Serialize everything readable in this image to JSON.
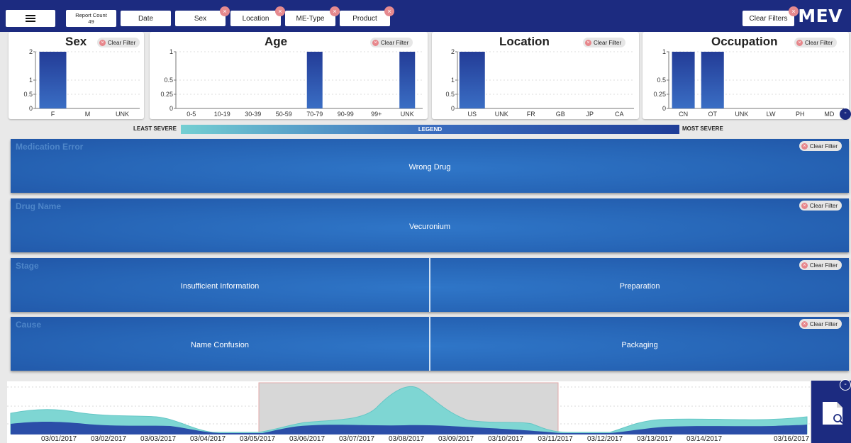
{
  "toolbar": {
    "report_count_label": "Report Count",
    "report_count_value": "49",
    "filters": [
      "Date",
      "Sex",
      "Location",
      "ME-Type",
      "Product"
    ],
    "clear_filters": "Clear Filters",
    "logo": "MEV"
  },
  "panels": {
    "clear_filter": "Clear Filter",
    "sex": {
      "title": "Sex",
      "categories": [
        "F",
        "M",
        "UNK"
      ],
      "values": [
        2,
        0,
        0
      ],
      "yticks": [
        "2",
        "1",
        "0.5",
        "0"
      ]
    },
    "age": {
      "title": "Age",
      "categories": [
        "0-5",
        "10-19",
        "30-39",
        "50-59",
        "70-79",
        "90-99",
        "99+",
        "UNK"
      ],
      "values": [
        0,
        0,
        0,
        0,
        1,
        0,
        0,
        1
      ],
      "yticks": [
        "1",
        "0.5",
        "0.25",
        "0"
      ]
    },
    "location": {
      "title": "Location",
      "categories": [
        "US",
        "UNK",
        "FR",
        "GB",
        "JP",
        "CA"
      ],
      "values": [
        2,
        0,
        0,
        0,
        0,
        0
      ],
      "yticks": [
        "2",
        "1",
        "0.5",
        "0"
      ]
    },
    "occupation": {
      "title": "Occupation",
      "categories": [
        "CN",
        "OT",
        "UNK",
        "LW",
        "PH",
        "MD"
      ],
      "values": [
        1,
        1,
        0,
        0,
        0,
        0
      ],
      "yticks": [
        "1",
        "0.5",
        "0.25",
        "0"
      ]
    },
    "toggle": "-"
  },
  "legend": {
    "least": "LEAST SEVERE",
    "center": "LEGEND",
    "most": "MOST SEVERE"
  },
  "categories": {
    "clear_filter": "Clear Filter",
    "medication_error": {
      "label": "Medication Error",
      "values": [
        "Wrong Drug"
      ]
    },
    "drug_name": {
      "label": "Drug Name",
      "values": [
        "Vecuronium"
      ]
    },
    "stage": {
      "label": "Stage",
      "values": [
        "Insufficient Information",
        "Preparation"
      ]
    },
    "cause": {
      "label": "Cause",
      "values": [
        "Name Confusion",
        "Packaging"
      ]
    }
  },
  "timeline": {
    "dates": [
      "03/01/2017",
      "03/02/2017",
      "03/03/2017",
      "03/04/2017",
      "03/05/2017",
      "03/06/2017",
      "03/07/2017",
      "03/08/2017",
      "03/09/2017",
      "03/10/2017",
      "03/11/2017",
      "03/12/2017",
      "03/13/2017",
      "03/14/2017",
      "03/16/2017"
    ],
    "toggle": "-"
  },
  "colors": {
    "navbar": "#1c2b80",
    "bar": "#2c58b3",
    "teal": "#74cfd2",
    "block": "#2766b7"
  }
}
